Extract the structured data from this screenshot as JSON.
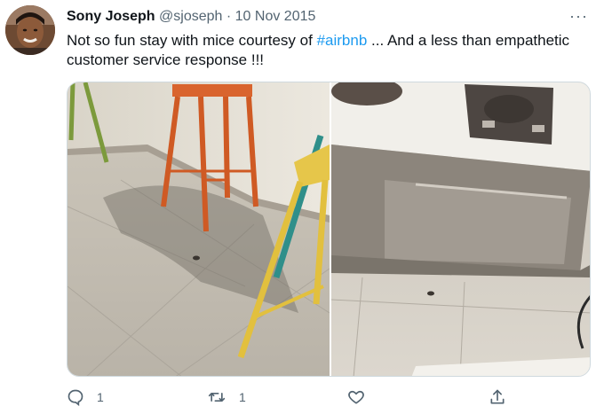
{
  "tweet": {
    "author_name": "Sony Joseph",
    "handle": "@sjoseph",
    "separator": "·",
    "date": "10 Nov 2015",
    "text_before": "Not so fun stay with mice courtesy of ",
    "hashtag": "#airbnb",
    "text_after": " ... And a less than empathetic customer service response !!!",
    "more_label": "···",
    "media": [
      {
        "description_icon": "photo-stools-on-tiled-floor"
      },
      {
        "description_icon": "photo-kitchen-cabinet-floor"
      }
    ]
  },
  "actions": {
    "reply": {
      "icon": "reply-icon",
      "count": "1"
    },
    "retweet": {
      "icon": "retweet-icon",
      "count": "1"
    },
    "like": {
      "icon": "heart-icon",
      "count": ""
    },
    "share": {
      "icon": "share-icon"
    }
  },
  "colors": {
    "accent": "#1d9bf0",
    "secondary_text": "#536471",
    "primary_text": "#0f1419"
  }
}
